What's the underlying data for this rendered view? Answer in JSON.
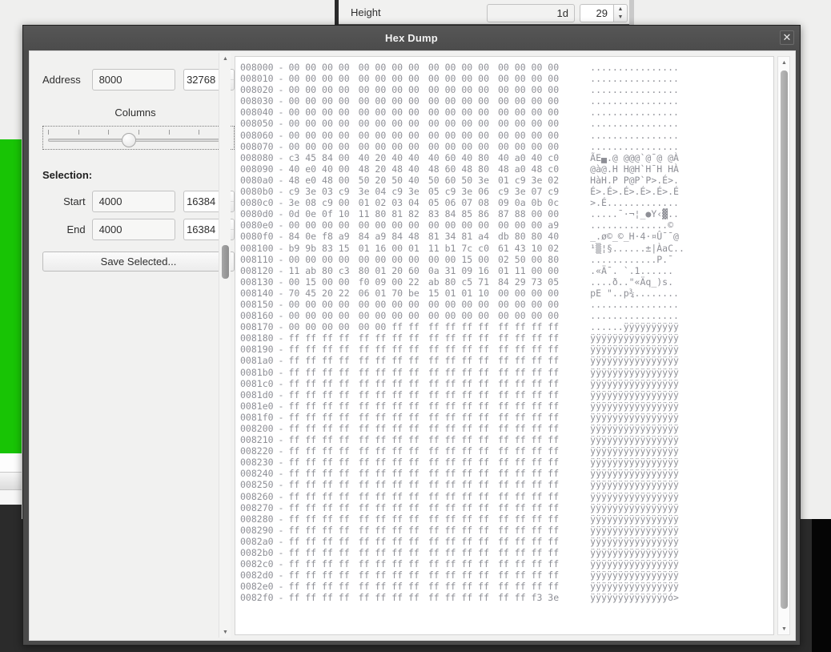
{
  "window": {
    "title": "Hex Dump",
    "close_label": "✕"
  },
  "top_toolbar": {
    "height_label": "Height",
    "height_hex": "1d",
    "height_dec": "29",
    "spin_up": "▲",
    "spin_down": "▼"
  },
  "left_panel": {
    "address_label": "Address",
    "address_hex": "8000",
    "address_dec": "32768",
    "columns_label": "Columns",
    "selection_label": "Selection:",
    "start_label": "Start",
    "start_hex": "4000",
    "start_dec": "16384",
    "end_label": "End",
    "end_hex": "4000",
    "end_dec": "16384",
    "save_label": "Save Selected...",
    "spin_up": "▲",
    "spin_down": "▼"
  },
  "scrollbars": {
    "up_glyph": "▲",
    "down_glyph": "▼"
  },
  "hex_dump": {
    "separator": "-",
    "rows": [
      {
        "addr": "008000",
        "groups": [
          "00 00 00 00",
          "00 00 00 00",
          "00 00 00 00",
          "00 00 00 00"
        ],
        "ascii": "................"
      },
      {
        "addr": "008010",
        "groups": [
          "00 00 00 00",
          "00 00 00 00",
          "00 00 00 00",
          "00 00 00 00"
        ],
        "ascii": "................"
      },
      {
        "addr": "008020",
        "groups": [
          "00 00 00 00",
          "00 00 00 00",
          "00 00 00 00",
          "00 00 00 00"
        ],
        "ascii": "................"
      },
      {
        "addr": "008030",
        "groups": [
          "00 00 00 00",
          "00 00 00 00",
          "00 00 00 00",
          "00 00 00 00"
        ],
        "ascii": "................"
      },
      {
        "addr": "008040",
        "groups": [
          "00 00 00 00",
          "00 00 00 00",
          "00 00 00 00",
          "00 00 00 00"
        ],
        "ascii": "................"
      },
      {
        "addr": "008050",
        "groups": [
          "00 00 00 00",
          "00 00 00 00",
          "00 00 00 00",
          "00 00 00 00"
        ],
        "ascii": "................"
      },
      {
        "addr": "008060",
        "groups": [
          "00 00 00 00",
          "00 00 00 00",
          "00 00 00 00",
          "00 00 00 00"
        ],
        "ascii": "................"
      },
      {
        "addr": "008070",
        "groups": [
          "00 00 00 00",
          "00 00 00 00",
          "00 00 00 00",
          "00 00 00 00"
        ],
        "ascii": "................"
      },
      {
        "addr": "008080",
        "groups": [
          "c3 45 84 00",
          "40 20 40 40",
          "40 60 40 80",
          "40 a0 40 c0"
        ],
        "ascii": "ÃE▄.@ @@@`@¯@ @À"
      },
      {
        "addr": "008090",
        "groups": [
          "40 e0 40 00",
          "48 20 48 40",
          "48 60 48 80",
          "48 a0 48 c0"
        ],
        "ascii": "@à@.H H@H`H¯H HÀ"
      },
      {
        "addr": "0080a0",
        "groups": [
          "48 e0 48 00",
          "50 20 50 40",
          "50 60 50 3e",
          "01 c9 3e 02"
        ],
        "ascii": "HàH.P P@P`P>.É>."
      },
      {
        "addr": "0080b0",
        "groups": [
          "c9 3e 03 c9",
          "3e 04 c9 3e",
          "05 c9 3e 06",
          "c9 3e 07 c9"
        ],
        "ascii": "É>.É>.É>.É>.É>.É"
      },
      {
        "addr": "0080c0",
        "groups": [
          "3e 08 c9 00",
          "01 02 03 04",
          "05 06 07 08",
          "09 0a 0b 0c"
        ],
        "ascii": ">.É............."
      },
      {
        "addr": "0080d0",
        "groups": [
          "0d 0e 0f 10",
          "11 80 81 82",
          "83 84 85 86",
          "87 88 00 00"
        ],
        "ascii": ".....¯·¬¦_●Υ‹▓.."
      },
      {
        "addr": "0080e0",
        "groups": [
          "00 00 00 00",
          "00 00 00 00",
          "00 00 00 00",
          "00 00 00 a9"
        ],
        "ascii": "..............©"
      },
      {
        "addr": "0080f0",
        "groups": [
          "84 0e f8 a9",
          "84 a9 84 48",
          "81 34 81 a4",
          "db 80 80 40"
        ],
        "ascii": "_.ø©_©_H·4·¤Û¯¯@"
      },
      {
        "addr": "008100",
        "groups": [
          "b9 9b 83 15",
          "01 16 00 01",
          "11 b1 7c c0",
          "61 43 10 02"
        ],
        "ascii": "¹▒¦§......±|ÀaC.."
      },
      {
        "addr": "008110",
        "groups": [
          "00 00 00 00",
          "00 00 00 00",
          "00 00 15 00",
          "02 50 00 80"
        ],
        "ascii": "............P.¯"
      },
      {
        "addr": "008120",
        "groups": [
          "11 ab 80 c3",
          "80 01 20 60",
          "0a 31 09 16",
          "01 11 00 00"
        ],
        "ascii": ".«Ä¯. `.1......"
      },
      {
        "addr": "008130",
        "groups": [
          "00 15 00 00",
          "f0 09 00 22",
          "ab 80 c5 71",
          "84 29 73 05"
        ],
        "ascii": "....ð..\"«Äq_)s."
      },
      {
        "addr": "008140",
        "groups": [
          "70 45 20 22",
          "06 01 70 be",
          "15 01 01 10",
          "00 00 00 00"
        ],
        "ascii": "pE \"..p¾........"
      },
      {
        "addr": "008150",
        "groups": [
          "00 00 00 00",
          "00 00 00 00",
          "00 00 00 00",
          "00 00 00 00"
        ],
        "ascii": "................"
      },
      {
        "addr": "008160",
        "groups": [
          "00 00 00 00",
          "00 00 00 00",
          "00 00 00 00",
          "00 00 00 00"
        ],
        "ascii": "................"
      },
      {
        "addr": "008170",
        "groups": [
          "00 00 00 00",
          "00 00 ff ff",
          "ff ff ff ff",
          "ff ff ff ff"
        ],
        "ascii": "......ÿÿÿÿÿÿÿÿÿÿ"
      },
      {
        "addr": "008180",
        "groups": [
          "ff ff ff ff",
          "ff ff ff ff",
          "ff ff ff ff",
          "ff ff ff ff"
        ],
        "ascii": "ÿÿÿÿÿÿÿÿÿÿÿÿÿÿÿÿ"
      },
      {
        "addr": "008190",
        "groups": [
          "ff ff ff ff",
          "ff ff ff ff",
          "ff ff ff ff",
          "ff ff ff ff"
        ],
        "ascii": "ÿÿÿÿÿÿÿÿÿÿÿÿÿÿÿÿ"
      },
      {
        "addr": "0081a0",
        "groups": [
          "ff ff ff ff",
          "ff ff ff ff",
          "ff ff ff ff",
          "ff ff ff ff"
        ],
        "ascii": "ÿÿÿÿÿÿÿÿÿÿÿÿÿÿÿÿ"
      },
      {
        "addr": "0081b0",
        "groups": [
          "ff ff ff ff",
          "ff ff ff ff",
          "ff ff ff ff",
          "ff ff ff ff"
        ],
        "ascii": "ÿÿÿÿÿÿÿÿÿÿÿÿÿÿÿÿ"
      },
      {
        "addr": "0081c0",
        "groups": [
          "ff ff ff ff",
          "ff ff ff ff",
          "ff ff ff ff",
          "ff ff ff ff"
        ],
        "ascii": "ÿÿÿÿÿÿÿÿÿÿÿÿÿÿÿÿ"
      },
      {
        "addr": "0081d0",
        "groups": [
          "ff ff ff ff",
          "ff ff ff ff",
          "ff ff ff ff",
          "ff ff ff ff"
        ],
        "ascii": "ÿÿÿÿÿÿÿÿÿÿÿÿÿÿÿÿ"
      },
      {
        "addr": "0081e0",
        "groups": [
          "ff ff ff ff",
          "ff ff ff ff",
          "ff ff ff ff",
          "ff ff ff ff"
        ],
        "ascii": "ÿÿÿÿÿÿÿÿÿÿÿÿÿÿÿÿ"
      },
      {
        "addr": "0081f0",
        "groups": [
          "ff ff ff ff",
          "ff ff ff ff",
          "ff ff ff ff",
          "ff ff ff ff"
        ],
        "ascii": "ÿÿÿÿÿÿÿÿÿÿÿÿÿÿÿÿ"
      },
      {
        "addr": "008200",
        "groups": [
          "ff ff ff ff",
          "ff ff ff ff",
          "ff ff ff ff",
          "ff ff ff ff"
        ],
        "ascii": "ÿÿÿÿÿÿÿÿÿÿÿÿÿÿÿÿ"
      },
      {
        "addr": "008210",
        "groups": [
          "ff ff ff ff",
          "ff ff ff ff",
          "ff ff ff ff",
          "ff ff ff ff"
        ],
        "ascii": "ÿÿÿÿÿÿÿÿÿÿÿÿÿÿÿÿ"
      },
      {
        "addr": "008220",
        "groups": [
          "ff ff ff ff",
          "ff ff ff ff",
          "ff ff ff ff",
          "ff ff ff ff"
        ],
        "ascii": "ÿÿÿÿÿÿÿÿÿÿÿÿÿÿÿÿ"
      },
      {
        "addr": "008230",
        "groups": [
          "ff ff ff ff",
          "ff ff ff ff",
          "ff ff ff ff",
          "ff ff ff ff"
        ],
        "ascii": "ÿÿÿÿÿÿÿÿÿÿÿÿÿÿÿÿ"
      },
      {
        "addr": "008240",
        "groups": [
          "ff ff ff ff",
          "ff ff ff ff",
          "ff ff ff ff",
          "ff ff ff ff"
        ],
        "ascii": "ÿÿÿÿÿÿÿÿÿÿÿÿÿÿÿÿ"
      },
      {
        "addr": "008250",
        "groups": [
          "ff ff ff ff",
          "ff ff ff ff",
          "ff ff ff ff",
          "ff ff ff ff"
        ],
        "ascii": "ÿÿÿÿÿÿÿÿÿÿÿÿÿÿÿÿ"
      },
      {
        "addr": "008260",
        "groups": [
          "ff ff ff ff",
          "ff ff ff ff",
          "ff ff ff ff",
          "ff ff ff ff"
        ],
        "ascii": "ÿÿÿÿÿÿÿÿÿÿÿÿÿÿÿÿ"
      },
      {
        "addr": "008270",
        "groups": [
          "ff ff ff ff",
          "ff ff ff ff",
          "ff ff ff ff",
          "ff ff ff ff"
        ],
        "ascii": "ÿÿÿÿÿÿÿÿÿÿÿÿÿÿÿÿ"
      },
      {
        "addr": "008280",
        "groups": [
          "ff ff ff ff",
          "ff ff ff ff",
          "ff ff ff ff",
          "ff ff ff ff"
        ],
        "ascii": "ÿÿÿÿÿÿÿÿÿÿÿÿÿÿÿÿ"
      },
      {
        "addr": "008290",
        "groups": [
          "ff ff ff ff",
          "ff ff ff ff",
          "ff ff ff ff",
          "ff ff ff ff"
        ],
        "ascii": "ÿÿÿÿÿÿÿÿÿÿÿÿÿÿÿÿ"
      },
      {
        "addr": "0082a0",
        "groups": [
          "ff ff ff ff",
          "ff ff ff ff",
          "ff ff ff ff",
          "ff ff ff ff"
        ],
        "ascii": "ÿÿÿÿÿÿÿÿÿÿÿÿÿÿÿÿ"
      },
      {
        "addr": "0082b0",
        "groups": [
          "ff ff ff ff",
          "ff ff ff ff",
          "ff ff ff ff",
          "ff ff ff ff"
        ],
        "ascii": "ÿÿÿÿÿÿÿÿÿÿÿÿÿÿÿÿ"
      },
      {
        "addr": "0082c0",
        "groups": [
          "ff ff ff ff",
          "ff ff ff ff",
          "ff ff ff ff",
          "ff ff ff ff"
        ],
        "ascii": "ÿÿÿÿÿÿÿÿÿÿÿÿÿÿÿÿ"
      },
      {
        "addr": "0082d0",
        "groups": [
          "ff ff ff ff",
          "ff ff ff ff",
          "ff ff ff ff",
          "ff ff ff ff"
        ],
        "ascii": "ÿÿÿÿÿÿÿÿÿÿÿÿÿÿÿÿ"
      },
      {
        "addr": "0082e0",
        "groups": [
          "ff ff ff ff",
          "ff ff ff ff",
          "ff ff ff ff",
          "ff ff ff ff"
        ],
        "ascii": "ÿÿÿÿÿÿÿÿÿÿÿÿÿÿÿÿ"
      },
      {
        "addr": "0082f0",
        "groups": [
          "ff ff ff ff",
          "ff ff ff ff",
          "ff ff ff ff",
          "ff ff f3 3e"
        ],
        "ascii": "ÿÿÿÿÿÿÿÿÿÿÿÿÿÿó>"
      }
    ]
  }
}
